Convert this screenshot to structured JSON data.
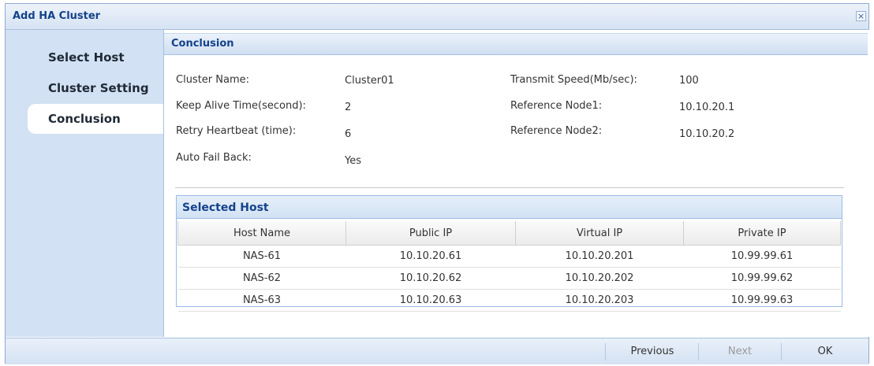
{
  "window": {
    "title": "Add HA Cluster",
    "close_glyph": "×"
  },
  "sidebar": {
    "items": [
      {
        "label": "Select Host",
        "active": false
      },
      {
        "label": "Cluster Setting",
        "active": false
      },
      {
        "label": "Conclusion",
        "active": true
      }
    ]
  },
  "conclusion": {
    "header": "Conclusion",
    "fields": {
      "cluster_name": {
        "label": "Cluster Name:",
        "value": "Cluster01"
      },
      "keep_alive": {
        "label": "Keep Alive Time(second):",
        "value": "2"
      },
      "retry_heartbeat": {
        "label": "Retry Heartbeat (time):",
        "value": "6"
      },
      "auto_fail_back": {
        "label": "Auto Fail Back:",
        "value": "Yes"
      },
      "transmit_speed": {
        "label": "Transmit Speed(Mb/sec):",
        "value": "100"
      },
      "reference_node1": {
        "label": "Reference Node1:",
        "value": "10.10.20.1"
      },
      "reference_node2": {
        "label": "Reference Node2:",
        "value": "10.10.20.2"
      }
    }
  },
  "selected_host": {
    "title": "Selected Host",
    "columns": [
      "Host Name",
      "Public IP",
      "Virtual IP",
      "Private IP"
    ],
    "rows": [
      [
        "NAS-61",
        "10.10.20.61",
        "10.10.20.201",
        "10.99.99.61"
      ],
      [
        "NAS-62",
        "10.10.20.62",
        "10.10.20.202",
        "10.99.99.62"
      ],
      [
        "NAS-63",
        "10.10.20.63",
        "10.10.20.203",
        "10.99.99.63"
      ]
    ]
  },
  "footer": {
    "previous": "Previous",
    "next": "Next",
    "ok": "OK",
    "next_disabled": true
  },
  "colors": {
    "title_text": "#15428b",
    "sidebar_bg": "#d2e1f3",
    "border": "#99bbe8"
  }
}
